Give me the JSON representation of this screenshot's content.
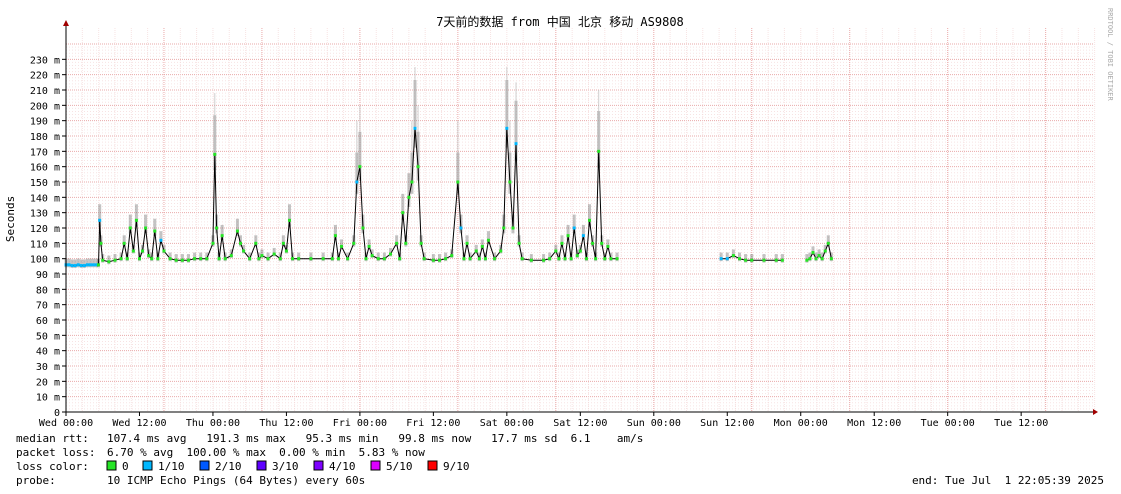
{
  "chart_data": {
    "type": "line",
    "title": "7天前的数据 from 中国 北京 移动 AS9808",
    "ylabel": "Seconds",
    "xlabel": "",
    "ylim": [
      0,
      240
    ],
    "y_ticks": [
      "0",
      "10 m",
      "20 m",
      "30 m",
      "40 m",
      "50 m",
      "60 m",
      "70 m",
      "80 m",
      "90 m",
      "100 m",
      "110 m",
      "120 m",
      "130 m",
      "140 m",
      "150 m",
      "160 m",
      "170 m",
      "180 m",
      "190 m",
      "200 m",
      "210 m",
      "220 m",
      "230 m"
    ],
    "x_ticks": [
      "Wed 00:00",
      "Wed 12:00",
      "Thu 00:00",
      "Thu 12:00",
      "Fri 00:00",
      "Fri 12:00",
      "Sat 00:00",
      "Sat 12:00",
      "Sun 00:00",
      "Sun 12:00",
      "Mon 00:00",
      "Mon 12:00",
      "Tue 00:00",
      "Tue 12:00"
    ],
    "watermark": "RRDTOOL / TOBI OETIKER",
    "grid": true,
    "series": [
      {
        "name": "median rtt (ms)",
        "points": [
          [
            0.0,
            96
          ],
          [
            0.5,
            96
          ],
          [
            1.0,
            95.5
          ],
          [
            1.5,
            95.5
          ],
          [
            2.0,
            96
          ],
          [
            2.5,
            95.5
          ],
          [
            3.0,
            95.5
          ],
          [
            3.5,
            96
          ],
          [
            4.0,
            96
          ],
          [
            4.5,
            96
          ],
          [
            5.0,
            96
          ],
          [
            5.3,
            96
          ],
          [
            5.5,
            125
          ],
          [
            5.7,
            110
          ],
          [
            6.0,
            99
          ],
          [
            7.0,
            98
          ],
          [
            8.0,
            99
          ],
          [
            9.0,
            100
          ],
          [
            9.5,
            110
          ],
          [
            10.0,
            100
          ],
          [
            10.5,
            120
          ],
          [
            11.0,
            105
          ],
          [
            11.5,
            125
          ],
          [
            12.0,
            100
          ],
          [
            12.5,
            105
          ],
          [
            13.0,
            120
          ],
          [
            13.5,
            102
          ],
          [
            14.0,
            100
          ],
          [
            14.5,
            118
          ],
          [
            15.0,
            100
          ],
          [
            15.5,
            112
          ],
          [
            16.0,
            105
          ],
          [
            17.0,
            100
          ],
          [
            18.0,
            99
          ],
          [
            19.0,
            99
          ],
          [
            20.0,
            99
          ],
          [
            21.0,
            100
          ],
          [
            22.0,
            100
          ],
          [
            23.0,
            100
          ],
          [
            24.0,
            110
          ],
          [
            24.3,
            168
          ],
          [
            24.6,
            120
          ],
          [
            25.0,
            100
          ],
          [
            25.5,
            115
          ],
          [
            26.0,
            100
          ],
          [
            27.0,
            102
          ],
          [
            28.0,
            118
          ],
          [
            28.5,
            110
          ],
          [
            29.0,
            105
          ],
          [
            30.0,
            100
          ],
          [
            31.0,
            110
          ],
          [
            31.5,
            100
          ],
          [
            32.0,
            102
          ],
          [
            33.0,
            100
          ],
          [
            34.0,
            103
          ],
          [
            35.0,
            100
          ],
          [
            35.5,
            110
          ],
          [
            36.0,
            105
          ],
          [
            36.5,
            125
          ],
          [
            37.0,
            100
          ],
          [
            38.0,
            100
          ],
          [
            40.0,
            100
          ],
          [
            42.0,
            100
          ],
          [
            43.5,
            100
          ],
          [
            44.0,
            115
          ],
          [
            44.5,
            100
          ],
          [
            45.0,
            108
          ],
          [
            46.0,
            100
          ],
          [
            47.0,
            110
          ],
          [
            47.5,
            150
          ],
          [
            48.0,
            160
          ],
          [
            48.5,
            120
          ],
          [
            49.0,
            100
          ],
          [
            49.5,
            108
          ],
          [
            50.0,
            102
          ],
          [
            51.0,
            100
          ],
          [
            52.0,
            100
          ],
          [
            53.0,
            103
          ],
          [
            54.0,
            110
          ],
          [
            54.5,
            100
          ],
          [
            55.0,
            130
          ],
          [
            55.5,
            110
          ],
          [
            56.0,
            140
          ],
          [
            56.5,
            150
          ],
          [
            57.0,
            185
          ],
          [
            57.5,
            160
          ],
          [
            58.0,
            110
          ],
          [
            58.5,
            100
          ],
          [
            60.0,
            99
          ],
          [
            61.0,
            99
          ],
          [
            62.0,
            100
          ],
          [
            63.0,
            102
          ],
          [
            64.0,
            150
          ],
          [
            64.5,
            120
          ],
          [
            65.0,
            100
          ],
          [
            65.5,
            110
          ],
          [
            66.0,
            100
          ],
          [
            67.0,
            105
          ],
          [
            67.5,
            100
          ],
          [
            68.0,
            108
          ],
          [
            68.5,
            100
          ],
          [
            69.0,
            112
          ],
          [
            70.0,
            100
          ],
          [
            71.0,
            105
          ],
          [
            71.5,
            120
          ],
          [
            72.0,
            185
          ],
          [
            72.5,
            150
          ],
          [
            73.0,
            120
          ],
          [
            73.5,
            175
          ],
          [
            74.0,
            110
          ],
          [
            74.5,
            100
          ],
          [
            76.0,
            99
          ],
          [
            78.0,
            99
          ],
          [
            79.0,
            100
          ],
          [
            80.0,
            105
          ],
          [
            80.5,
            100
          ],
          [
            81.0,
            110
          ],
          [
            81.5,
            100
          ],
          [
            82.0,
            115
          ],
          [
            82.5,
            100
          ],
          [
            83.0,
            120
          ],
          [
            83.5,
            102
          ],
          [
            84.0,
            105
          ],
          [
            84.5,
            115
          ],
          [
            85.0,
            100
          ],
          [
            85.5,
            125
          ],
          [
            86.0,
            110
          ],
          [
            86.5,
            100
          ],
          [
            87.0,
            170
          ],
          [
            87.5,
            110
          ],
          [
            88.0,
            100
          ],
          [
            88.5,
            108
          ],
          [
            89.0,
            100
          ],
          [
            90.0,
            100
          ]
        ],
        "points_b": [
          [
            107.0,
            100
          ],
          [
            108.0,
            100
          ],
          [
            109.0,
            102
          ],
          [
            110.0,
            100
          ],
          [
            111.0,
            99
          ],
          [
            112.0,
            99
          ],
          [
            114.0,
            99
          ],
          [
            116.0,
            99
          ],
          [
            117.0,
            99
          ]
        ],
        "points_c": [
          [
            121.0,
            99
          ],
          [
            121.5,
            100
          ],
          [
            122.0,
            104
          ],
          [
            122.5,
            100
          ],
          [
            123.0,
            102
          ],
          [
            123.5,
            100
          ],
          [
            124.0,
            105
          ],
          [
            124.5,
            110
          ],
          [
            125.0,
            100
          ]
        ]
      }
    ],
    "stats": {
      "median_rtt_label": "median rtt:",
      "median_rtt": "107.4 ms avg   191.3 ms max   95.3 ms min   99.8 ms now   17.7 ms sd  6.1    am/s",
      "packet_loss_label": "packet loss:",
      "packet_loss": "6.70 % avg  100.00 % max  0.00 % min  5.83 % now",
      "loss_color_label": "loss color:",
      "loss_colors": [
        {
          "label": "0",
          "color": "#26e526"
        },
        {
          "label": "1/10",
          "color": "#00b8ff"
        },
        {
          "label": "2/10",
          "color": "#0059ff"
        },
        {
          "label": "3/10",
          "color": "#5e00ff"
        },
        {
          "label": "4/10",
          "color": "#7e00ff"
        },
        {
          "label": "5/10",
          "color": "#dd00ff"
        },
        {
          "label": "9/10",
          "color": "#ff0000"
        }
      ],
      "probe_label": "probe:",
      "probe": "10 ICMP Echo Pings (64 Bytes) every 60s",
      "end": "end: Tue Jul  1 22:05:39 2025"
    }
  }
}
